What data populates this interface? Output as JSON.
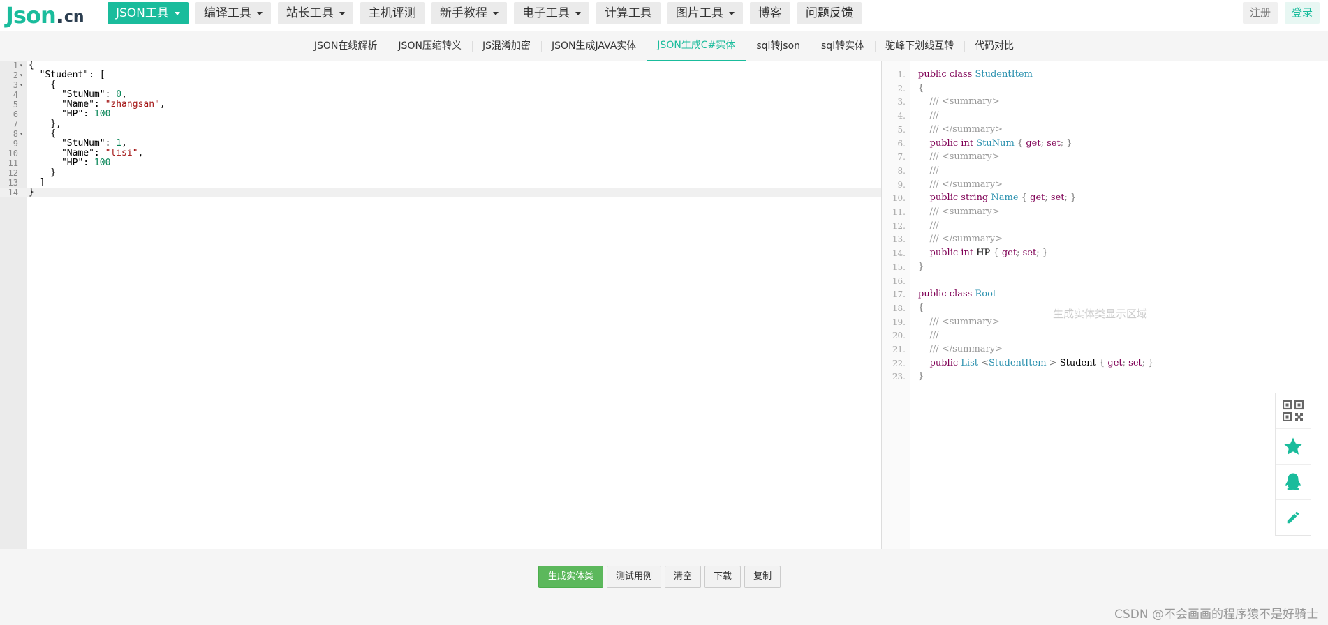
{
  "logo": {
    "main": "Json",
    "dot": ".",
    "suffix": "cn"
  },
  "nav": [
    {
      "label": "JSON工具",
      "dropdown": true,
      "active": true
    },
    {
      "label": "编译工具",
      "dropdown": true
    },
    {
      "label": "站长工具",
      "dropdown": true
    },
    {
      "label": "主机评测",
      "dropdown": false
    },
    {
      "label": "新手教程",
      "dropdown": true
    },
    {
      "label": "电子工具",
      "dropdown": true
    },
    {
      "label": "计算工具",
      "dropdown": false
    },
    {
      "label": "图片工具",
      "dropdown": true
    },
    {
      "label": "博客",
      "dropdown": false
    },
    {
      "label": "问题反馈",
      "dropdown": false
    }
  ],
  "auth": {
    "register": "注册",
    "login": "登录"
  },
  "subtabs": [
    {
      "label": "JSON在线解析"
    },
    {
      "label": "JSON压缩转义"
    },
    {
      "label": "JS混淆加密"
    },
    {
      "label": "JSON生成JAVA实体"
    },
    {
      "label": "JSON生成C#实体",
      "active": true
    },
    {
      "label": "sql转json"
    },
    {
      "label": "sql转实体"
    },
    {
      "label": "驼峰下划线互转"
    },
    {
      "label": "代码对比"
    }
  ],
  "editor": {
    "lines": [
      {
        "n": "1",
        "fold": true,
        "text": "{"
      },
      {
        "n": "2",
        "fold": true,
        "text": "  \"Student\": ["
      },
      {
        "n": "3",
        "fold": true,
        "text": "    {"
      },
      {
        "n": "4",
        "text": "      \"StuNum\": 0,"
      },
      {
        "n": "5",
        "text": "      \"Name\": \"zhangsan\","
      },
      {
        "n": "6",
        "text": "      \"HP\": 100"
      },
      {
        "n": "7",
        "text": "    },"
      },
      {
        "n": "8",
        "fold": true,
        "text": "    {"
      },
      {
        "n": "9",
        "text": "      \"StuNum\": 1,"
      },
      {
        "n": "10",
        "text": "      \"Name\": \"lisi\","
      },
      {
        "n": "11",
        "text": "      \"HP\": 100"
      },
      {
        "n": "12",
        "text": "    }"
      },
      {
        "n": "13",
        "text": "  ]"
      },
      {
        "n": "14",
        "text": "}",
        "current": true
      }
    ]
  },
  "output": {
    "placeholder": "生成实体类显示区域",
    "lines": [
      "public class StudentItem",
      "{",
      "    /// <summary>",
      "    ///",
      "    /// </summary>",
      "    public int StuNum { get; set; }",
      "    /// <summary>",
      "    ///",
      "    /// </summary>",
      "    public string Name { get; set; }",
      "    /// <summary>",
      "    ///",
      "    /// </summary>",
      "    public int HP { get; set; }",
      "}",
      "",
      "public class Root",
      "{",
      "    /// <summary>",
      "    ///",
      "    /// </summary>",
      "    public List <StudentItem > Student { get; set; }",
      "}"
    ]
  },
  "float_tools": [
    {
      "icon": "qrcode-icon"
    },
    {
      "icon": "star-icon"
    },
    {
      "icon": "qq-icon"
    },
    {
      "icon": "pencil-icon"
    }
  ],
  "actions": {
    "generate": "生成实体类",
    "test": "测试用例",
    "clear": "清空",
    "download": "下载",
    "copy": "复制"
  },
  "credit": "CSDN @不会画画的程序猿不是好骑士",
  "colors": {
    "accent": "#1abc9c",
    "primary_button": "#5cb85c"
  }
}
